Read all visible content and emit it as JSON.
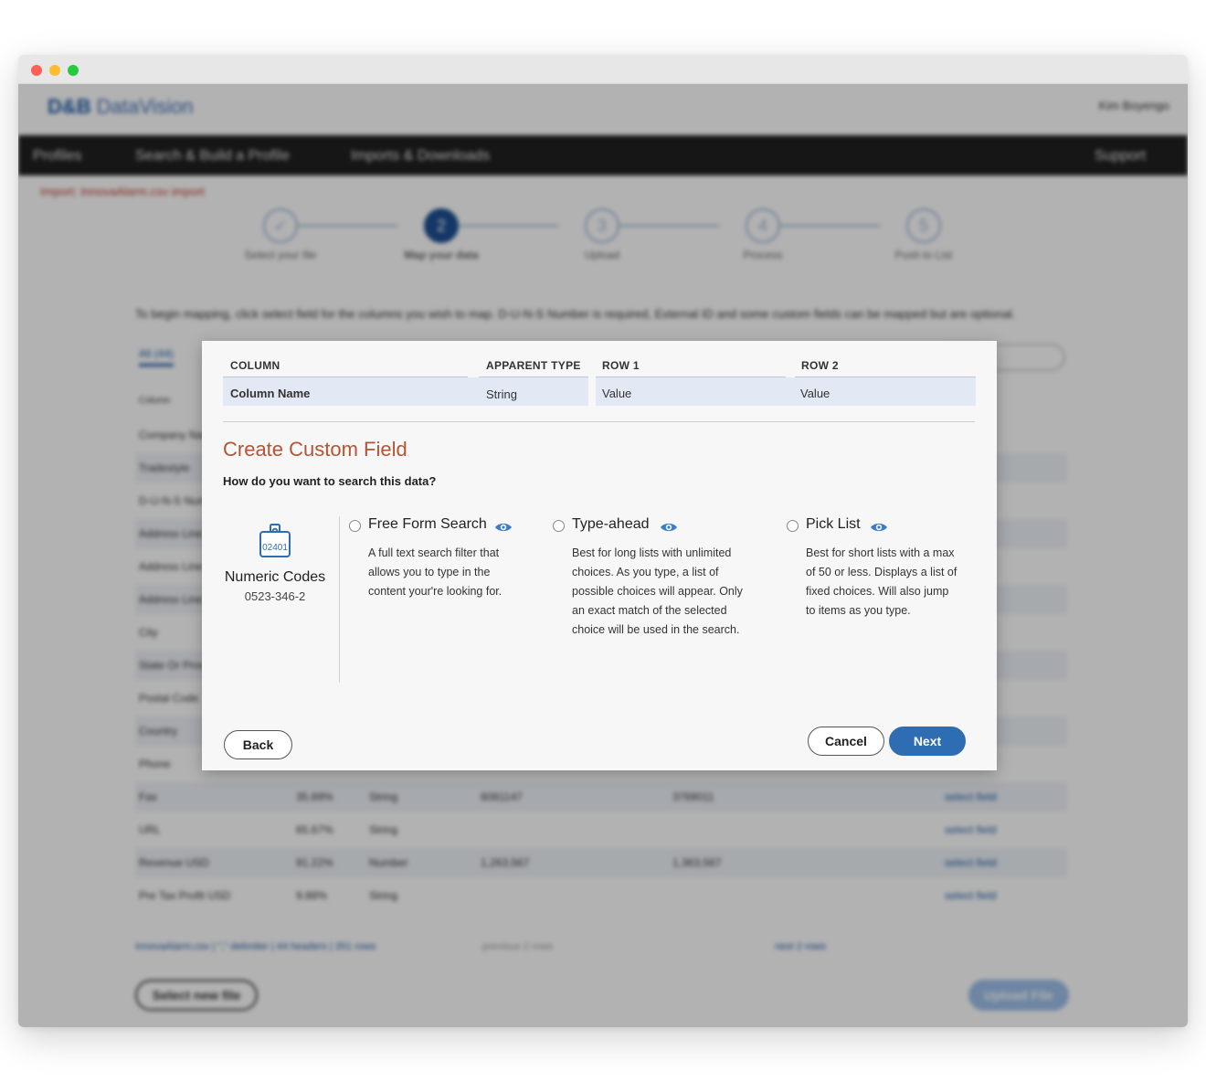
{
  "background": {
    "logo": {
      "brand": "D&B",
      "product": "DataVision"
    },
    "user_menu": "Kim Boyengo",
    "nav": {
      "profiles": "Profiles",
      "search_build": "Search & Build a Profile",
      "imports": "Imports & Downloads",
      "support": "Support"
    },
    "breadcrumb": "Import: InnovaAlarm.csv import",
    "steps": [
      {
        "num": "✓",
        "label": "Select your file"
      },
      {
        "num": "2",
        "label": "Map your data"
      },
      {
        "num": "3",
        "label": "Upload"
      },
      {
        "num": "4",
        "label": "Process"
      },
      {
        "num": "5",
        "label": "Push to List"
      }
    ],
    "instructions": "To begin mapping, click select field for the columns you wish to map. D-U-N-S Number is required, External ID and some custom fields can be mapped but are optional.",
    "tab_all": "All (44)",
    "table_header": "Column",
    "rows": [
      {
        "name": "Company Name",
        "pct": "",
        "type": "",
        "r1": "",
        "r2": "",
        "action": ""
      },
      {
        "name": "Tradestyle",
        "pct": "",
        "type": "",
        "r1": "",
        "r2": "",
        "action": ""
      },
      {
        "name": "D-U-N-S Number",
        "pct": "",
        "type": "",
        "r1": "",
        "r2": "",
        "action": ""
      },
      {
        "name": "Address Line 1",
        "pct": "",
        "type": "",
        "r1": "",
        "r2": "",
        "action": ""
      },
      {
        "name": "Address Line 2",
        "pct": "",
        "type": "",
        "r1": "",
        "r2": "",
        "action": ""
      },
      {
        "name": "Address Line 3",
        "pct": "",
        "type": "",
        "r1": "",
        "r2": "",
        "action": ""
      },
      {
        "name": "City",
        "pct": "",
        "type": "",
        "r1": "",
        "r2": "",
        "action": ""
      },
      {
        "name": "State Or Province",
        "pct": "",
        "type": "",
        "r1": "",
        "r2": "",
        "action": ""
      },
      {
        "name": "Postal Code",
        "pct": "",
        "type": "",
        "r1": "",
        "r2": "",
        "action": ""
      },
      {
        "name": "Country",
        "pct": "",
        "type": "",
        "r1": "",
        "r2": "",
        "action": ""
      },
      {
        "name": "Phone",
        "pct": "",
        "type": "",
        "r1": "",
        "r2": "",
        "action": ""
      },
      {
        "name": "Fax",
        "pct": "35.89%",
        "type": "String",
        "r1": "6081147",
        "r2": "3769011",
        "action": "select field"
      },
      {
        "name": "URL",
        "pct": "65.67%",
        "type": "String",
        "r1": "",
        "r2": "",
        "action": "select field"
      },
      {
        "name": "Revenue USD",
        "pct": "91.22%",
        "type": "Number",
        "r1": "1,263,567",
        "r2": "1,363,567",
        "action": "select field"
      },
      {
        "name": "Pre Tax Profit USD",
        "pct": "9.88%",
        "type": "String",
        "r1": "",
        "r2": "",
        "action": "select field"
      }
    ],
    "file_info": "InnovaAlarm.csv | \",\" delimiter | 44 headers | 351 rows",
    "prev_label": "previous 2 rows",
    "next_label": "next 2 rows",
    "select_new_file": "Select new file",
    "upload_file": "Upload File"
  },
  "modal": {
    "table": {
      "headers": {
        "column": "COLUMN",
        "apparent_type": "APPARENT TYPE",
        "row1": "ROW 1",
        "row2": "ROW 2"
      },
      "row": {
        "column": "Column Name",
        "apparent_type": "String",
        "row1": "Value",
        "row2": "Value"
      }
    },
    "title": "Create Custom Field",
    "question": "How do you want to search this data?",
    "field_preview": {
      "icon": "numeric-code-icon",
      "icon_text": "02401",
      "name": "Numeric Codes",
      "sample": "0523-346-2"
    },
    "options": [
      {
        "title": "Free Form Search",
        "desc_lines": [
          "A full text search filter that",
          "allows you to type in the",
          "content your're looking for."
        ]
      },
      {
        "title": "Type-ahead",
        "desc_lines": [
          "Best for long lists with unlimited",
          "choices. As you type, a list of",
          "possible choices will appear. Only",
          "an exact match of the selected",
          "choice will be used in the search."
        ]
      },
      {
        "title": "Pick List",
        "desc_lines": [
          "Best for short lists with a max",
          "of 50 or less. Displays a list of",
          "fixed choices. Will also jump",
          "to items as you type."
        ]
      }
    ],
    "buttons": {
      "back": "Back",
      "cancel": "Cancel",
      "next": "Next"
    },
    "colors": {
      "title": "#b55336",
      "primary": "#2f6db3",
      "eye": "#3d7cc9"
    }
  }
}
